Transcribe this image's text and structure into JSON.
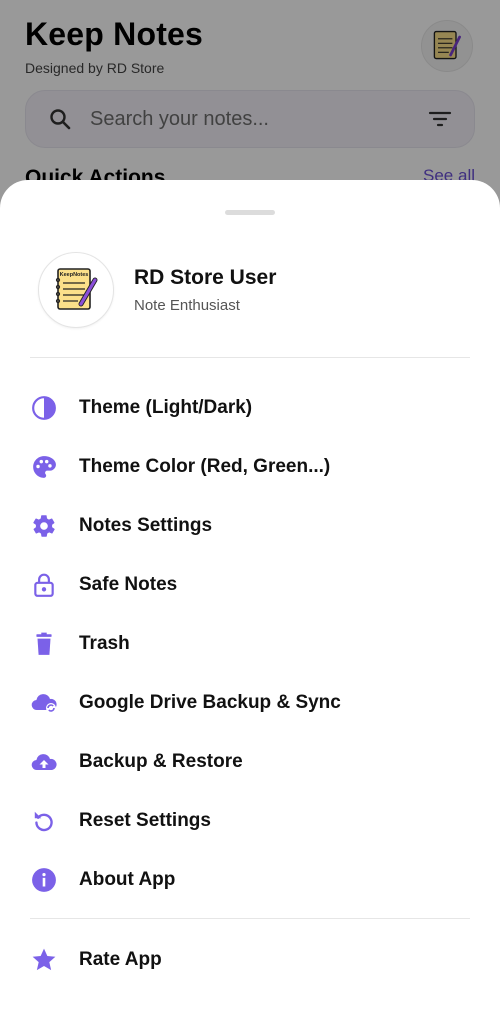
{
  "app": {
    "title": "Keep Notes",
    "subtitle": "Designed by RD Store",
    "search_placeholder": "Search your notes...",
    "quick_actions_label": "Quick Actions",
    "see_all_label": "See all"
  },
  "profile": {
    "name": "RD Store User",
    "role": "Note Enthusiast",
    "logo_text": "KeepNotes"
  },
  "menu": {
    "items": [
      {
        "label": "Theme (Light/Dark)",
        "icon": "contrast-icon"
      },
      {
        "label": "Theme Color (Red, Green...)",
        "icon": "palette-icon"
      },
      {
        "label": "Notes Settings",
        "icon": "gear-icon"
      },
      {
        "label": "Safe Notes",
        "icon": "lock-icon"
      },
      {
        "label": "Trash",
        "icon": "trash-icon"
      },
      {
        "label": "Google Drive Backup & Sync",
        "icon": "cloud-sync-icon"
      },
      {
        "label": "Backup & Restore",
        "icon": "cloud-upload-icon"
      },
      {
        "label": "Reset Settings",
        "icon": "reset-icon"
      },
      {
        "label": "About App",
        "icon": "info-icon"
      }
    ],
    "rate": {
      "label": "Rate App",
      "icon": "star-icon"
    }
  },
  "colors": {
    "accent": "#7b61e8",
    "scrim": "rgba(0,0,0,0.40)",
    "text": "#111111"
  }
}
